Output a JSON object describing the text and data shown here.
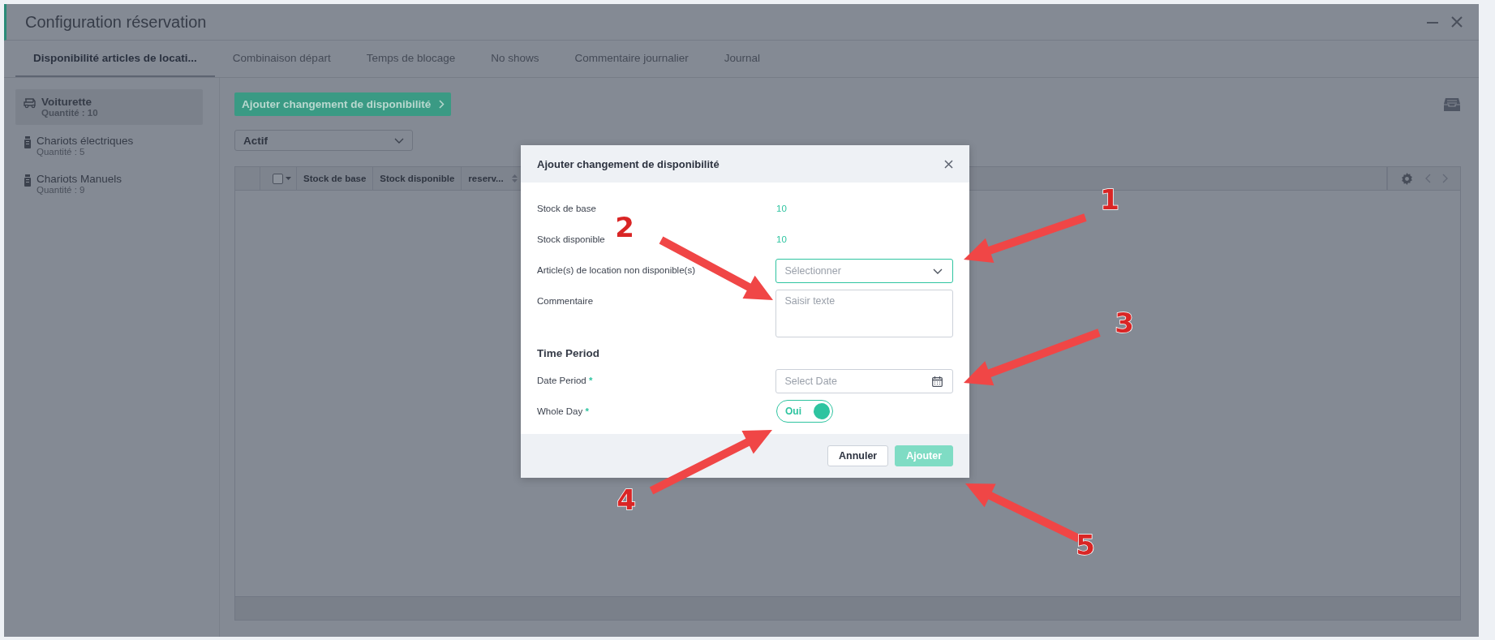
{
  "window": {
    "title": "Configuration réservation"
  },
  "tabs": [
    {
      "label": "Disponibilité articles de locati...",
      "selected": true
    },
    {
      "label": "Combinaison départ",
      "selected": false
    },
    {
      "label": "Temps de blocage",
      "selected": false
    },
    {
      "label": "No shows",
      "selected": false
    },
    {
      "label": "Commentaire journalier",
      "selected": false
    },
    {
      "label": "Journal",
      "selected": false
    }
  ],
  "sidebar": {
    "items": [
      {
        "kind": "cart",
        "name": "Voiturette",
        "quantity": "Quantité : 10",
        "selected": true
      },
      {
        "kind": "bag",
        "name": "Chariots électriques",
        "quantity": "Quantité : 5",
        "selected": false
      },
      {
        "kind": "bag",
        "name": "Chariots Manuels",
        "quantity": "Quantité : 9",
        "selected": false
      }
    ]
  },
  "toolbar": {
    "add_button": "Ajouter changement de disponibilité",
    "filter_value": "Actif"
  },
  "table": {
    "select_all_checked": false,
    "columns": [
      {
        "label": "Stock de base",
        "sortable": false
      },
      {
        "label": "Stock disponible",
        "sortable": false
      },
      {
        "label": "reserv...",
        "sortable": true
      }
    ]
  },
  "dialog": {
    "title": "Ajouter changement de disponibilité",
    "rows": [
      {
        "kind": "value",
        "label": "Stock de base",
        "value": "10"
      },
      {
        "kind": "value",
        "label": "Stock disponible",
        "value": "10"
      },
      {
        "kind": "select",
        "label": "Article(s) de location non disponible(s)",
        "placeholder": "Sélectionner",
        "focused": true
      },
      {
        "kind": "textarea",
        "label": "Commentaire",
        "placeholder": "Saisir texte",
        "focused": false
      }
    ],
    "section_title": "Time Period",
    "period_rows": [
      {
        "kind": "date",
        "label": "Date Period",
        "required_mark": "*",
        "placeholder": "Select Date",
        "focused": false
      },
      {
        "kind": "toggle",
        "label": "Whole Day",
        "required_mark": "*",
        "on": true,
        "value": "Oui"
      }
    ],
    "buttons": [
      {
        "kind": "secondary",
        "label": "Annuler",
        "disabled": false
      },
      {
        "kind": "primary",
        "label": "Ajouter",
        "disabled": true
      }
    ]
  },
  "annotations": [
    {
      "label": "1"
    },
    {
      "label": "2"
    },
    {
      "label": "3"
    },
    {
      "label": "4"
    },
    {
      "label": "5"
    }
  ]
}
